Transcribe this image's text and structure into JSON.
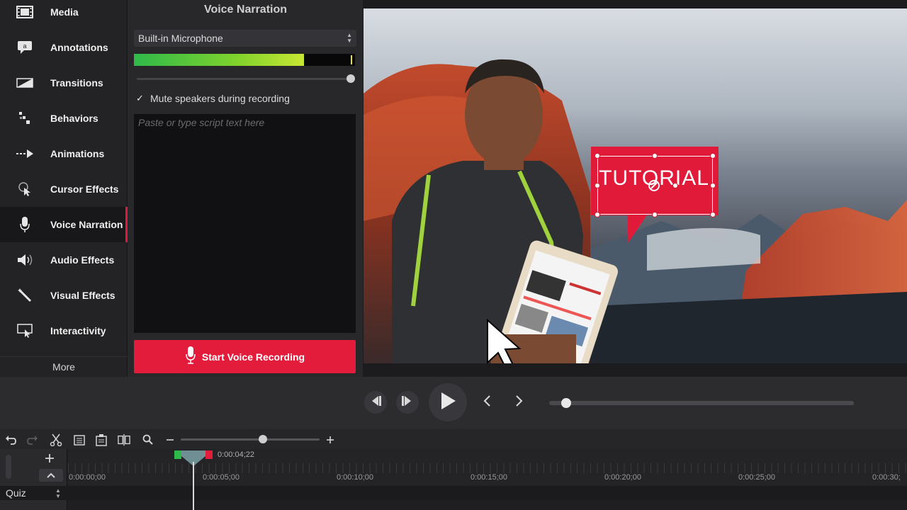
{
  "sidebar": {
    "items": [
      {
        "label": "Media",
        "icon": "film-strip-icon"
      },
      {
        "label": "Annotations",
        "icon": "speech-bubble-icon"
      },
      {
        "label": "Transitions",
        "icon": "transition-icon"
      },
      {
        "label": "Behaviors",
        "icon": "behaviors-icon"
      },
      {
        "label": "Animations",
        "icon": "arrow-icon"
      },
      {
        "label": "Cursor Effects",
        "icon": "cursor-icon"
      },
      {
        "label": "Voice Narration",
        "icon": "microphone-icon"
      },
      {
        "label": "Audio Effects",
        "icon": "speaker-icon"
      },
      {
        "label": "Visual Effects",
        "icon": "magic-wand-icon"
      },
      {
        "label": "Interactivity",
        "icon": "interactivity-icon"
      }
    ],
    "active_index": 6,
    "more_label": "More"
  },
  "panel": {
    "title": "Voice Narration",
    "mic_device": "Built-in Microphone",
    "input_level": 0.77,
    "input_volume": 1.0,
    "mute_checked": true,
    "mute_label": "Mute speakers during recording",
    "script_placeholder": "Paste or type script text here",
    "record_label": "Start Voice Recording"
  },
  "canvas": {
    "callout_text": "TUTORIAL",
    "callout_color": "#e21a3a"
  },
  "playback": {
    "position": 0.03
  },
  "timeline": {
    "zoom_level": 0.59,
    "playhead_time": "0:00:04;22",
    "ticks": [
      "0:00:00;00",
      "0:00:05;00",
      "0:00:10;00",
      "0:00:15;00",
      "0:00:20;00",
      "0:00:25;00",
      "0:00:30;"
    ],
    "track_label": "Quiz"
  },
  "colors": {
    "accent": "#e41c3c"
  }
}
